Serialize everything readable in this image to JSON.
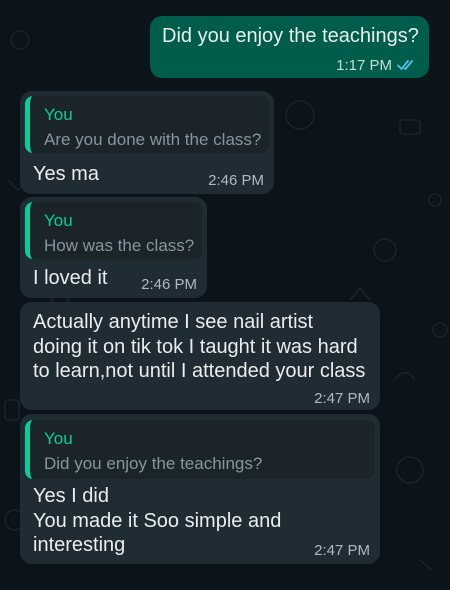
{
  "colors": {
    "background": "#0b141a",
    "outgoing_bubble": "#005c4b",
    "incoming_bubble": "#202c33",
    "quote_accent": "#06cf9c",
    "read_ticks": "#53bdeb"
  },
  "messages": [
    {
      "direction": "outgoing",
      "text": "Did you enjoy the teachings?",
      "time": "1:17 PM",
      "status_icon": "double-check-icon"
    },
    {
      "direction": "incoming",
      "quote": {
        "author": "You",
        "text": "Are you done with the class?"
      },
      "text": "Yes ma",
      "time": "2:46 PM"
    },
    {
      "direction": "incoming",
      "quote": {
        "author": "You",
        "text": "How was the class?"
      },
      "text": "I loved it",
      "time": "2:46 PM"
    },
    {
      "direction": "incoming",
      "text": "Actually anytime I see nail artist\ndoing it on tik tok I taught it was hard\nto learn,not until I attended your class",
      "time": "2:47 PM"
    },
    {
      "direction": "incoming",
      "quote": {
        "author": "You",
        "text": "Did you enjoy the teachings?"
      },
      "text": "Yes I did\nYou made it Soo simple and\ninteresting",
      "time": "2:47 PM"
    }
  ]
}
